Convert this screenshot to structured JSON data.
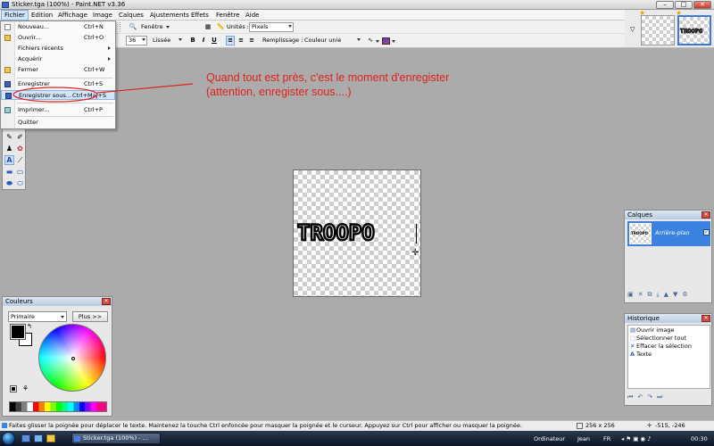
{
  "window": {
    "title": "Sticker.tga (100%) - Paint.NET v3.36",
    "minimize": "–",
    "maximize": "□",
    "close": "✕"
  },
  "menubar": [
    "Fichier",
    "Edition",
    "Affichage",
    "Image",
    "Calques",
    "Ajustements",
    "Effets",
    "Fenêtre",
    "Aide"
  ],
  "toolbar": {
    "font_size": "36",
    "smoothing": "Lissée",
    "window_mode": "Fenêtre",
    "units_label": "Unités :",
    "units_value": "Pixels",
    "fill_label": "Remplissage :",
    "fill_value": "Couleur unie",
    "bold": "B",
    "italic": "I",
    "underline": "U"
  },
  "file_menu": [
    {
      "label": "Nouveau...",
      "shortcut": "Ctrl+N",
      "icon": "new-icon"
    },
    {
      "label": "Ouvrir...",
      "shortcut": "Ctrl+O",
      "icon": "open-icon"
    },
    {
      "label": "Fichiers récents",
      "shortcut": "",
      "icon": ""
    },
    {
      "label": "Acquérir",
      "shortcut": "",
      "icon": ""
    },
    {
      "label": "Fermer",
      "shortcut": "Ctrl+W",
      "icon": "close-file-icon"
    },
    {
      "label": "Enregistrer",
      "shortcut": "Ctrl+S",
      "icon": "save-icon"
    },
    {
      "label": "Enregistrer sous...",
      "shortcut": "Ctrl+Maj+S",
      "icon": "save-as-icon"
    },
    {
      "label": "Imprimer...",
      "shortcut": "Ctrl+P",
      "icon": "print-icon"
    },
    {
      "label": "Quitter",
      "shortcut": "",
      "icon": ""
    }
  ],
  "annotation": {
    "line1": "Quand tout est près, c'est le moment d'enregister",
    "line2": "(attention, enregister sous....)",
    "color": "#e1211a"
  },
  "canvas": {
    "text": "TROOPO"
  },
  "thumbnails": {
    "second_label": "TROOPO"
  },
  "colors_panel": {
    "title": "Couleurs",
    "mode": "Primaire",
    "more_button": "Plus >>",
    "primary": "#000000",
    "secondary": "#ffffff"
  },
  "layers_panel": {
    "title": "Calques",
    "layer_name": "Arrière-plan",
    "thumb_label": "TROOPO"
  },
  "history_panel": {
    "title": "Historique",
    "items": [
      "Ouvrir image",
      "Sélectionner tout",
      "Effacer la sélection",
      "Texte"
    ]
  },
  "statusbar": {
    "message": "Faites glisser la poignée pour déplacer le texte. Maintenez la touche Ctrl enfoncée pour masquer la poignée et le curseur. Appuyez sur Ctrl pour afficher ou masquer la poignée.",
    "image_size": "256 x 256",
    "cursor_pos": "-515, -246"
  },
  "taskbar": {
    "task_label": "Sticker.tga (100%) - ...",
    "computer": "Ordinateur",
    "user": "Jean",
    "lang": "FR",
    "time": "00:30"
  }
}
